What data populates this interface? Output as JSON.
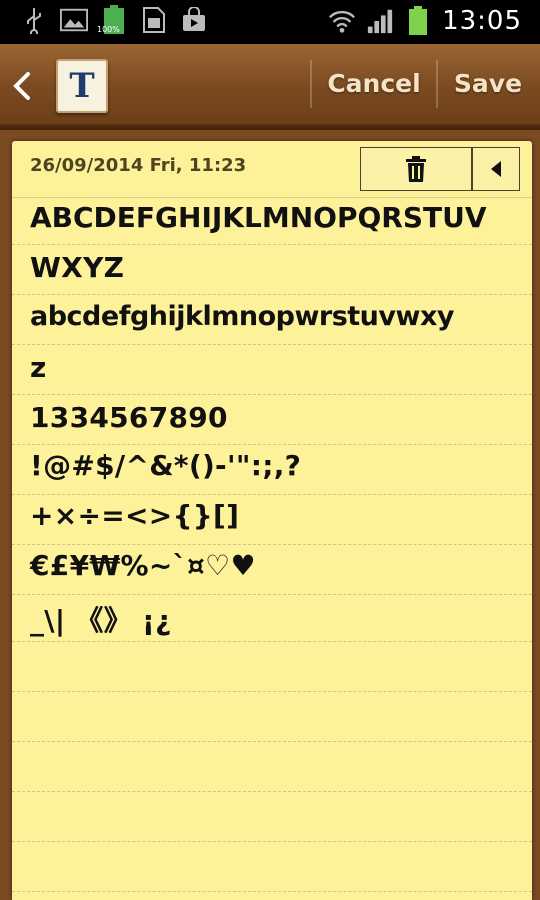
{
  "status_bar": {
    "time": "13:05",
    "battery_label": "100%"
  },
  "action_bar": {
    "back_icon": "back-chevron-icon",
    "app_icon_letter": "T",
    "cancel_label": "Cancel",
    "save_label": "Save"
  },
  "note": {
    "date": "26/09/2014 Fri, 11:23",
    "lines": [
      "ABCDEFGHIJKLMNOPQRSTUV",
      "WXYZ",
      "abcdefghijklmnopwrstuvwxy",
      "z",
      "1334567890",
      "!@#$/^&*()-'\":;,?",
      "+×÷=<>{}[]",
      "€£¥₩%~`¤♡♥",
      "_\\| 《》 ¡¿"
    ]
  },
  "colors": {
    "paper": "#fdf19a",
    "wood": "#7b4a21",
    "ink": "#111111"
  }
}
